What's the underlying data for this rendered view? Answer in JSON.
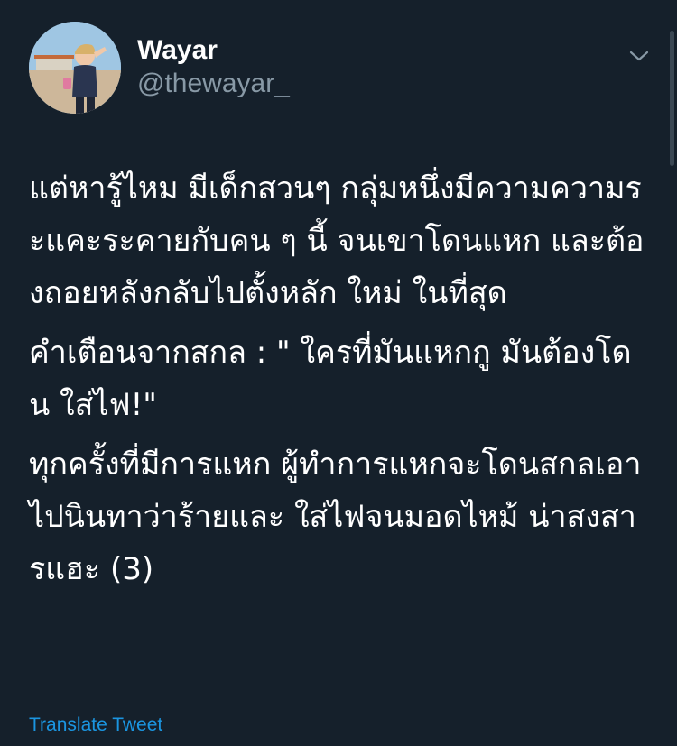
{
  "tweet": {
    "author": {
      "display_name": "Wayar",
      "handle": "@thewayar_",
      "avatar_icon": "user-avatar-photo"
    },
    "more_icon": "chevron-down-icon",
    "paragraphs": [
      "แต่หารู้ไหม มีเด็กสวนๆ กลุ่มหนึ่งมีความความระแคะระคายกับคน ๆ นี้ จนเขาโดนแหก และต้องถอยหลังกลับไปตั้งหลัก ใหม่ ในที่สุด",
      "คำเตือนจากสกล : \" ใครที่มันแหกกู มันต้องโดน ใส่ไฟ!\"",
      "ทุกครั้งที่มีการแหก ผู้ทำการแหกจะโดนสกลเอาไปนินทาว่าร้ายและ ใส่ไฟจนมอดไหม้ น่าสงสารแฮะ (3)"
    ],
    "translate_label": "Translate Tweet"
  },
  "colors": {
    "background": "#15202b",
    "text_primary": "#ffffff",
    "text_secondary": "#8899a6",
    "link": "#1b95e0"
  }
}
